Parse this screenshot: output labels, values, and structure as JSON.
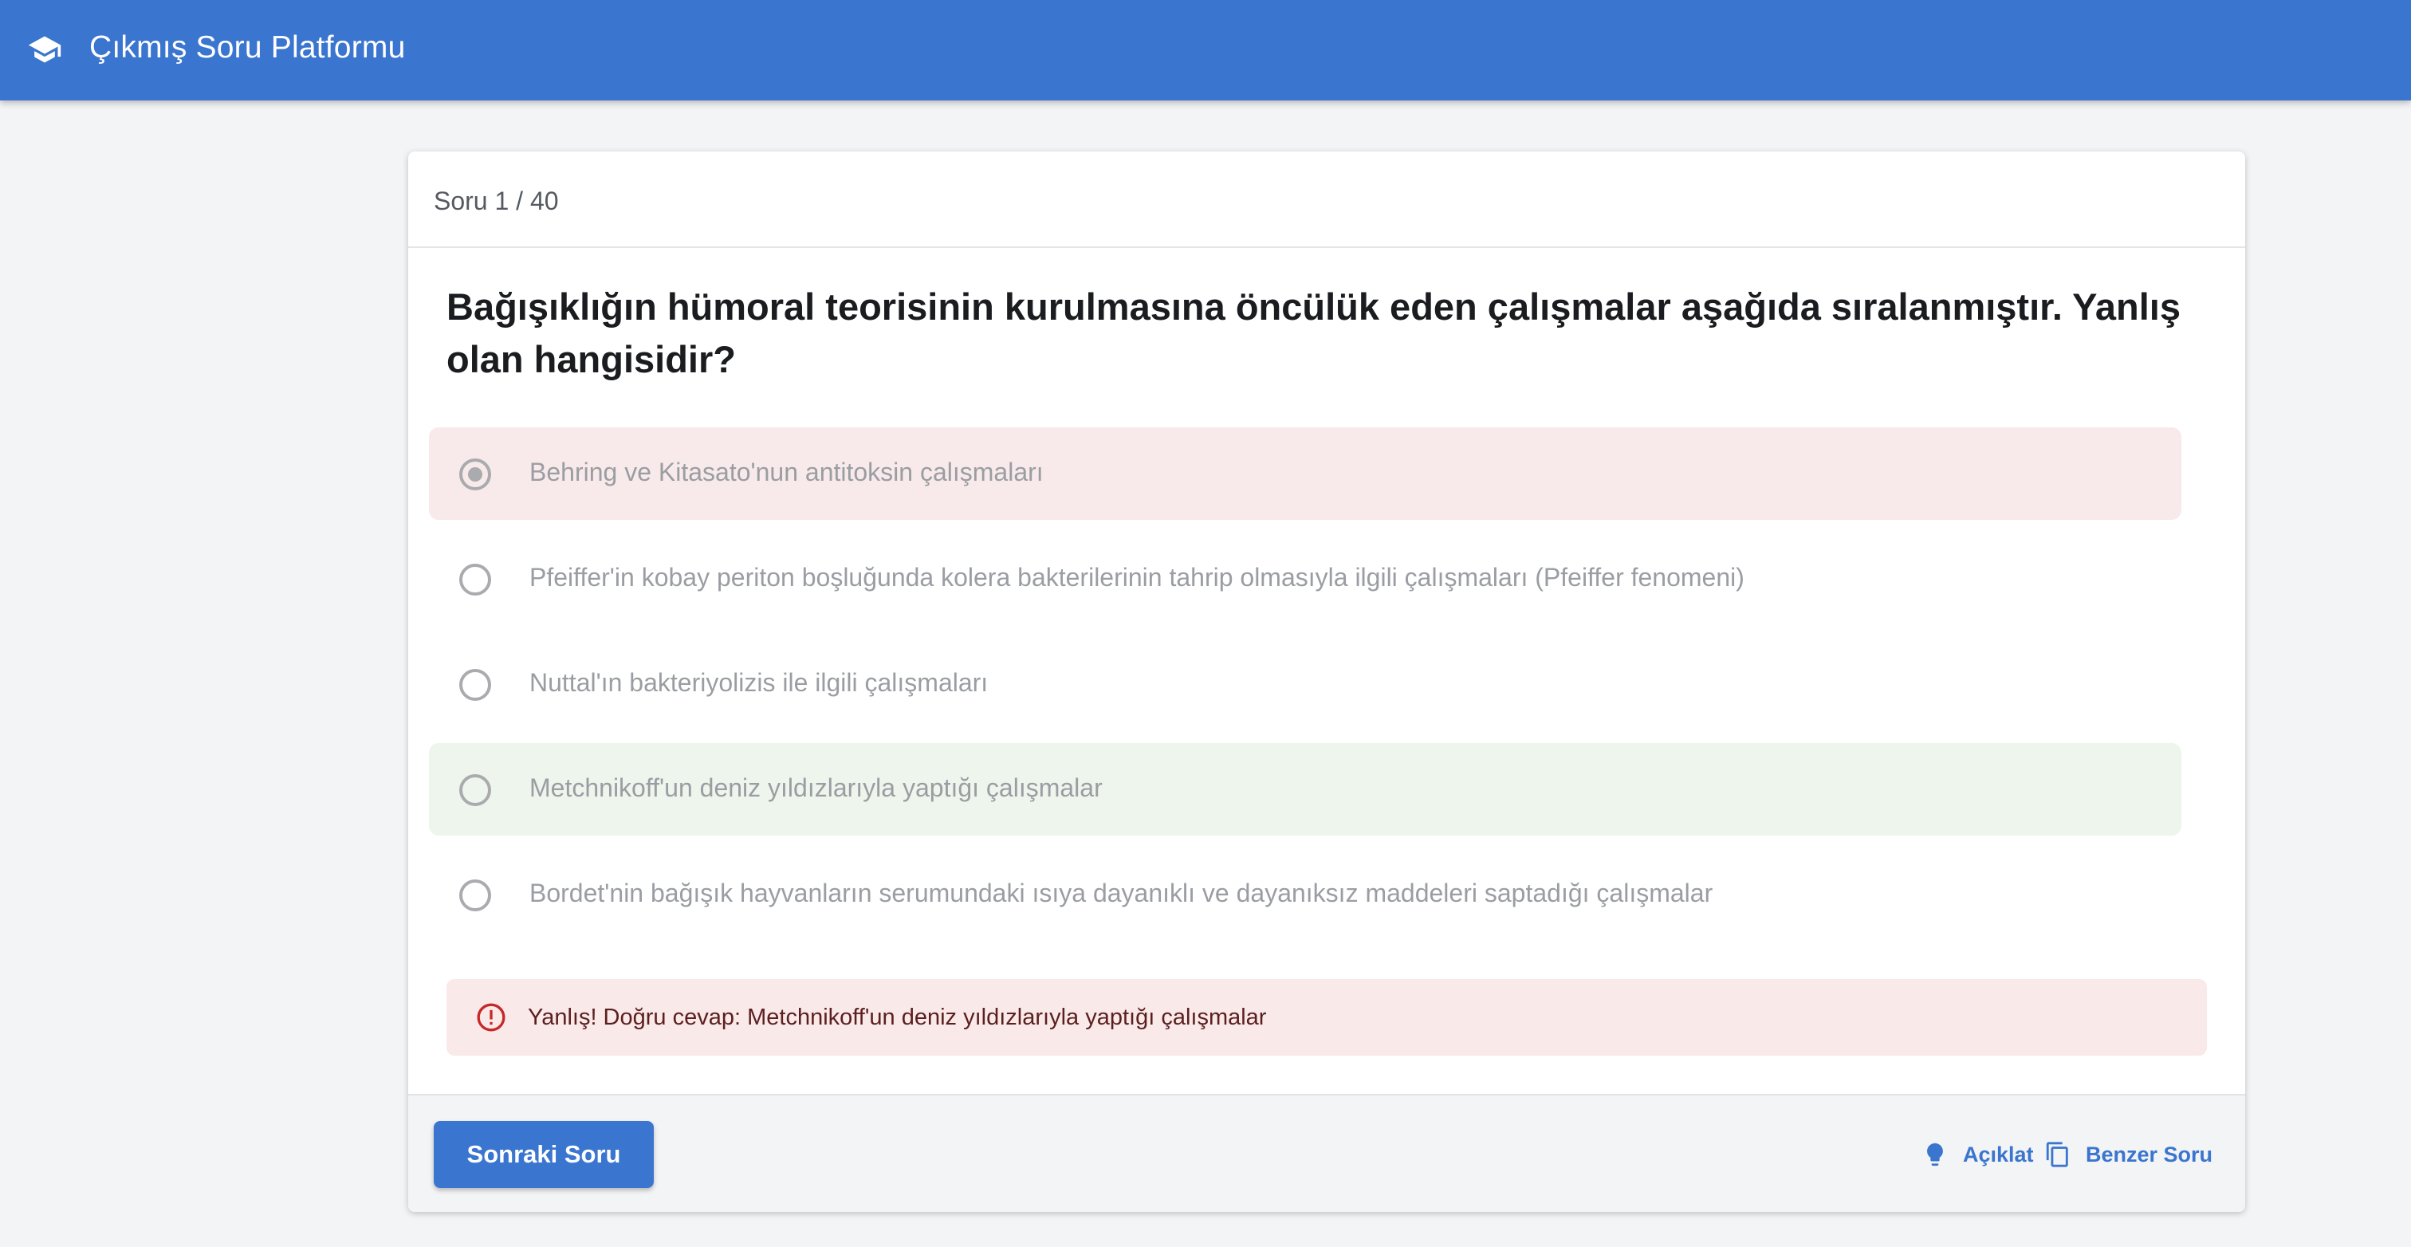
{
  "app": {
    "title": "Çıkmış Soru Platformu",
    "logo_icon": "graduation-cap-icon",
    "brand_color": "#3a75cf"
  },
  "quiz": {
    "counter": "Soru 1 / 40",
    "question": "Bağışıklığın hümoral teorisinin kurulmasına öncülük eden çalışmalar aşağıda sıralanmıştır. Yanlış olan hangisidir?",
    "options": [
      {
        "label": "Behring ve Kitasato'nun antitoksin çalışmaları",
        "selected": true,
        "state": "wrong"
      },
      {
        "label": "Pfeiffer'in kobay periton boşluğunda kolera bakterilerinin tahrip olmasıyla ilgili çalışmaları (Pfeiffer fenomeni)",
        "selected": false,
        "state": "none"
      },
      {
        "label": "Nuttal'ın bakteriyolizis ile ilgili çalışmaları",
        "selected": false,
        "state": "none"
      },
      {
        "label": "Metchnikoff'un deniz yıldızlarıyla yaptığı çalışmalar",
        "selected": false,
        "state": "correct"
      },
      {
        "label": "Bordet'nin bağışık hayvanların serumundaki ısıya dayanıklı ve dayanıksız maddeleri saptadığı çalışmalar",
        "selected": false,
        "state": "none"
      }
    ],
    "feedback": {
      "icon": "error-circle-icon",
      "message": "Yanlış! Doğru cevap: Metchnikoff'un deniz yıldızlarıyla yaptığı çalışmalar",
      "color": "#c62828"
    }
  },
  "footer": {
    "next_label": "Sonraki Soru",
    "explain_label": "Açıklat",
    "explain_icon": "lightbulb-icon",
    "similar_label": "Benzer Soru",
    "similar_icon": "copy-icon"
  }
}
